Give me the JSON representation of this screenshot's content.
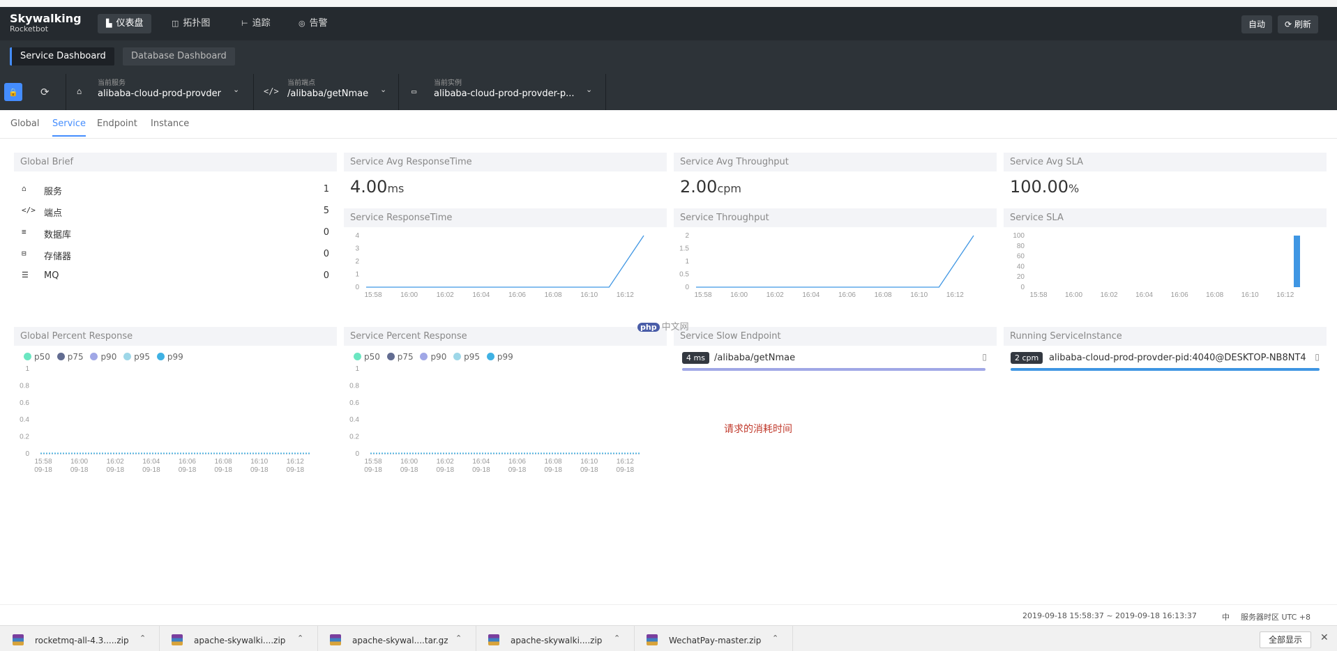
{
  "app": {
    "logo": "Skywalking",
    "sublogo": "Rocketbot"
  },
  "topnav": [
    {
      "icon": "▙",
      "label": "仪表盘",
      "active": true
    },
    {
      "icon": "◫",
      "label": "拓扑图",
      "active": false
    },
    {
      "icon": "⊢",
      "label": "追踪",
      "active": false
    },
    {
      "icon": "◎",
      "label": "告警",
      "active": false
    }
  ],
  "topright": {
    "auto": "自动",
    "refresh_icon": "⟳",
    "refresh": "刷新"
  },
  "dashboards": [
    "Service Dashboard",
    "Database Dashboard"
  ],
  "selectors": {
    "lock_icon": "🔒",
    "refresh_icon": "⟳",
    "service": {
      "label": "当前服务",
      "value": "alibaba-cloud-prod-provder",
      "icon": "⌂"
    },
    "endpoint": {
      "label": "当前端点",
      "value": "/alibaba/getNmae",
      "icon": "</>"
    },
    "instance": {
      "label": "当前实例",
      "value": "alibaba-cloud-prod-provder-p...",
      "icon": "▭"
    },
    "chevron": "⌄"
  },
  "subtabs": [
    "Global",
    "Service",
    "Endpoint",
    "Instance"
  ],
  "global_brief": {
    "title": "Global Brief",
    "rows": [
      {
        "icon": "⌂",
        "label": "服务",
        "value": "1"
      },
      {
        "icon": "</>",
        "label": "端点",
        "value": "5"
      },
      {
        "icon": "≡",
        "label": "数据库",
        "value": "0"
      },
      {
        "icon": "⊟",
        "label": "存储器",
        "value": "0"
      },
      {
        "icon": "☰",
        "label": "MQ",
        "value": "0"
      }
    ]
  },
  "avg_cards": [
    {
      "title": "Service Avg ResponseTime",
      "value": "4.00",
      "unit": "ms"
    },
    {
      "title": "Service Avg Throughput",
      "value": "2.00",
      "unit": "cpm"
    },
    {
      "title": "Service Avg SLA",
      "value": "100.00",
      "unit": "%"
    }
  ],
  "times": [
    "15:58",
    "16:00",
    "16:02",
    "16:04",
    "16:06",
    "16:08",
    "16:10",
    "16:12"
  ],
  "date": "09-18",
  "chart_titles": {
    "rt": "Service ResponseTime",
    "tp": "Service Throughput",
    "sla": "Service SLA",
    "gpr": "Global Percent Response",
    "spr": "Service Percent Response"
  },
  "chart_data": [
    {
      "type": "line",
      "title": "Service ResponseTime",
      "x": [
        "15:58",
        "16:00",
        "16:02",
        "16:04",
        "16:06",
        "16:08",
        "16:10",
        "16:12",
        "16:13"
      ],
      "values": [
        0,
        0,
        0,
        0,
        0,
        0,
        0,
        0,
        4
      ],
      "yticks": [
        0,
        1,
        2,
        3,
        4
      ],
      "ylim": [
        0,
        4
      ],
      "color": "#3f96e3"
    },
    {
      "type": "line",
      "title": "Service Throughput",
      "x": [
        "15:58",
        "16:00",
        "16:02",
        "16:04",
        "16:06",
        "16:08",
        "16:10",
        "16:12",
        "16:13"
      ],
      "values": [
        0,
        0,
        0,
        0,
        0,
        0,
        0,
        0,
        2
      ],
      "yticks": [
        0,
        0.5,
        1,
        1.5,
        2
      ],
      "ylim": [
        0,
        2
      ],
      "color": "#3f96e3"
    },
    {
      "type": "bar",
      "title": "Service SLA",
      "x": [
        "16:13"
      ],
      "values": [
        100
      ],
      "yticks": [
        0,
        20,
        40,
        60,
        80,
        100
      ],
      "ylim": [
        0,
        100
      ],
      "color": "#3f96e3"
    },
    {
      "type": "line",
      "title": "Global Percent Response",
      "series": [
        "p50",
        "p75",
        "p90",
        "p95",
        "p99"
      ],
      "values": [
        0,
        0,
        0,
        0,
        0,
        0,
        0,
        0,
        0
      ],
      "yticks": [
        0,
        0.2,
        0.4,
        0.6,
        0.8,
        1
      ],
      "ylim": [
        0,
        1
      ]
    },
    {
      "type": "line",
      "title": "Service Percent Response",
      "series": [
        "p50",
        "p75",
        "p90",
        "p95",
        "p99"
      ],
      "values": [
        0,
        0,
        0,
        0,
        0,
        0,
        0,
        0,
        0
      ],
      "yticks": [
        0,
        0.2,
        0.4,
        0.6,
        0.8,
        1
      ],
      "ylim": [
        0,
        1
      ]
    }
  ],
  "legend": [
    {
      "name": "p50",
      "color": "#6be6c1"
    },
    {
      "name": "p75",
      "color": "#626c91"
    },
    {
      "name": "p90",
      "color": "#a0a7e6"
    },
    {
      "name": "p95",
      "color": "#9ed7e8"
    },
    {
      "name": "p99",
      "color": "#3fb1e3"
    }
  ],
  "slow_endpoint": {
    "title": "Service Slow Endpoint",
    "badge": "4 ms",
    "name": "/alibaba/getNmae",
    "bar_color": "#a0a7e6"
  },
  "running_instance": {
    "title": "Running ServiceInstance",
    "badge": "2 cpm",
    "name": "alibaba-cloud-prod-provder-pid:4040@DESKTOP-NB8NT4I",
    "bar_color": "#3f96e3"
  },
  "annotation": "请求的消耗时间",
  "watermark": {
    "badge": "php",
    "text": "中文网"
  },
  "footer": {
    "range": "2019-09-18 15:58:37 ~ 2019-09-18 16:13:37",
    "lang": "中",
    "tz": "服务器时区 UTC +8"
  },
  "downloads": [
    "rocketmq-all-4.3.....zip",
    "apache-skywalki....zip",
    "apache-skywal....tar.gz",
    "apache-skywalki....zip",
    "WechatPay-master.zip"
  ],
  "download_bar": {
    "show_all": "全部显示",
    "close": "✕",
    "expand": "⌃"
  }
}
